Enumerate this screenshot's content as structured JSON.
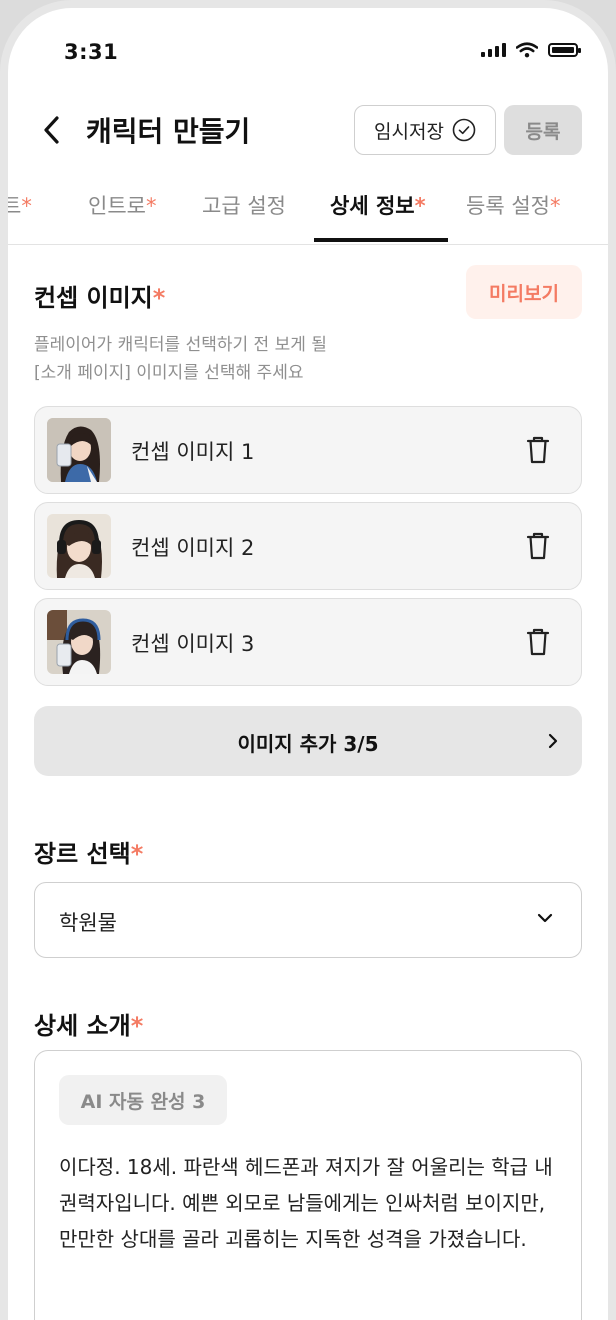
{
  "status_bar": {
    "time": "3:31"
  },
  "header": {
    "title": "캐릭터 만들기",
    "draft_label": "임시저장",
    "register_label": "등록"
  },
  "tabs": [
    {
      "label": "트",
      "required": true
    },
    {
      "label": "인트로",
      "required": true
    },
    {
      "label": "고급 설정",
      "required": false
    },
    {
      "label": "상세 정보",
      "required": true,
      "active": true
    },
    {
      "label": "등록 설정",
      "required": true
    }
  ],
  "required_mark": "*",
  "concept": {
    "title": "컨셉 이미지",
    "preview_label": "미리보기",
    "desc_line1": "플레이어가 캐릭터를 선택하기 전 보게 될",
    "desc_line2": "[소개 페이지] 이미지를 선택해 주세요",
    "images": [
      {
        "label": "컨셉 이미지 1"
      },
      {
        "label": "컨셉 이미지 2"
      },
      {
        "label": "컨셉 이미지 3"
      }
    ],
    "add_label": "이미지 추가 3/5"
  },
  "genre": {
    "title": "장르 선택",
    "selected": "학원물"
  },
  "detail": {
    "title": "상세 소개",
    "ai_button": "AI 자동 완성 3",
    "text": "이다정. 18세. 파란색 헤드폰과 져지가 잘 어울리는 학급 내 권력자입니다. 예쁜 외모로 남들에게는 인싸처럼 보이지만, 만만한 상대를 골라 괴롭히는 지독한 성격을 가졌습니다."
  },
  "colors": {
    "accent": "#f47b63",
    "accent_bg": "#fff1ec",
    "disabled_bg": "#dedede"
  }
}
